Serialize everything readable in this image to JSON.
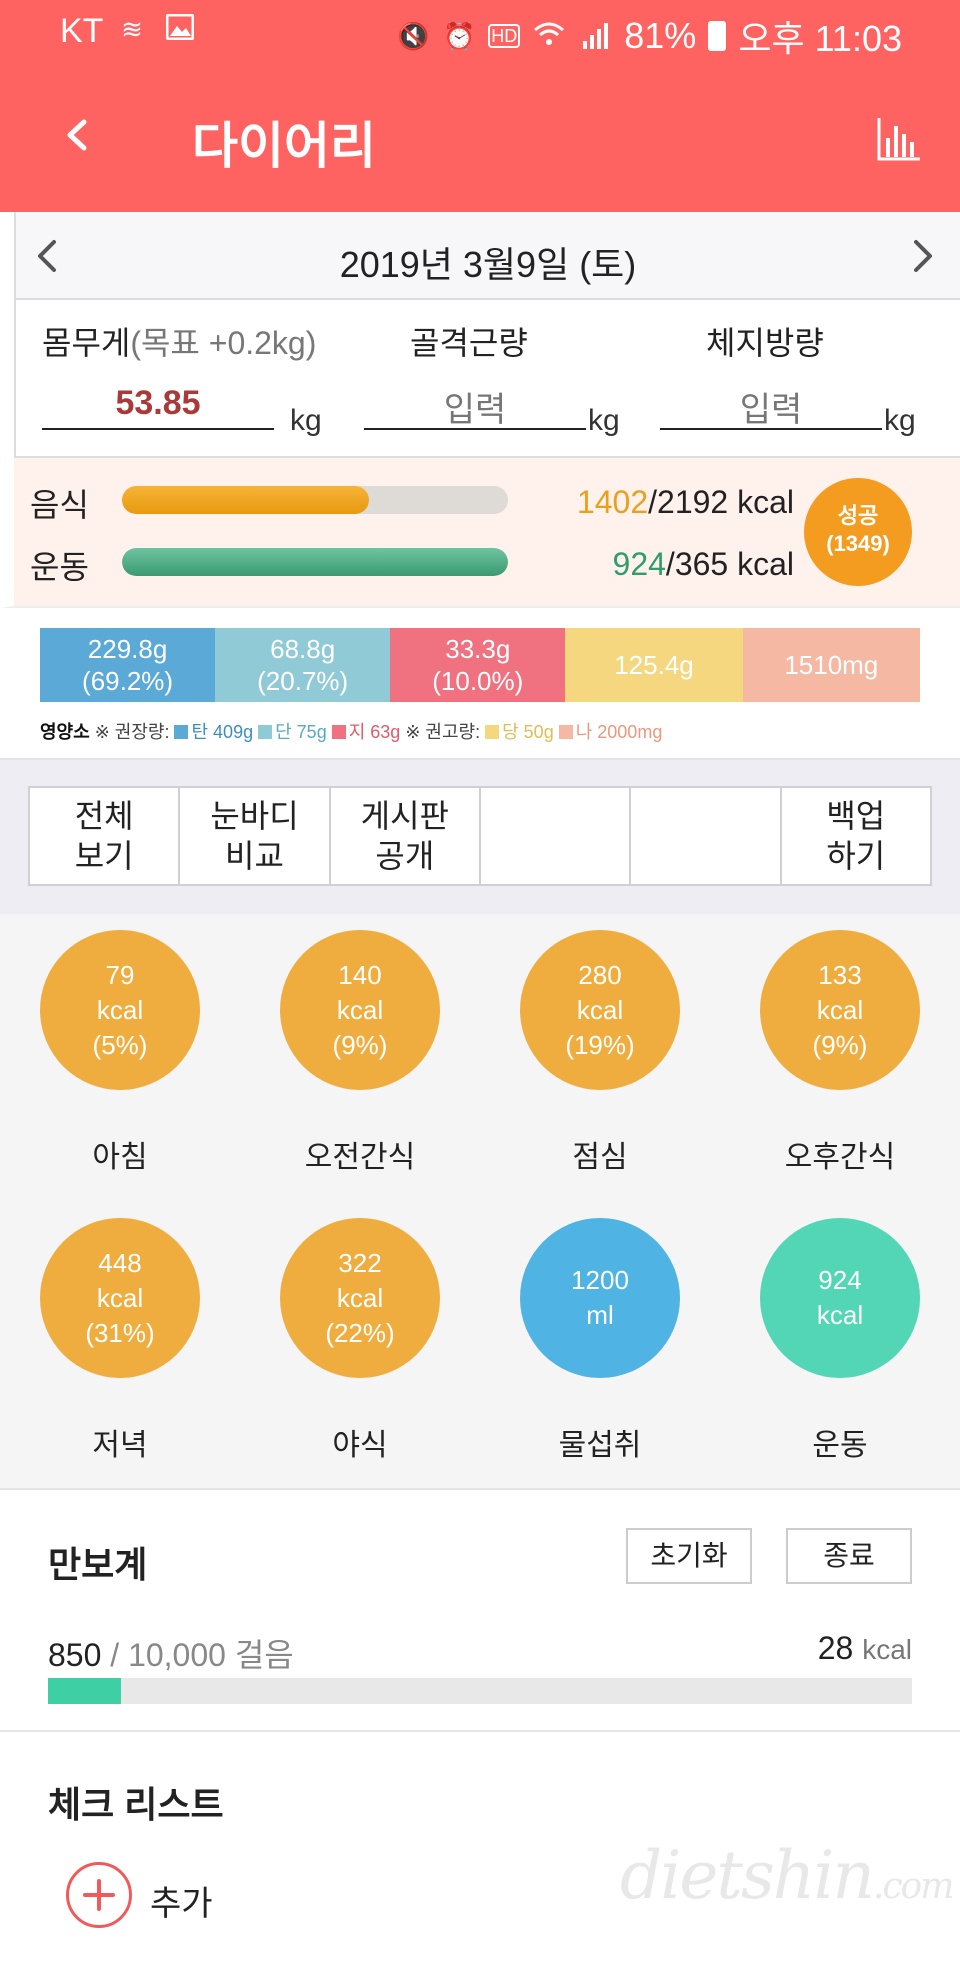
{
  "status_bar": {
    "carrier": "KT",
    "battery": "81%",
    "time": "오후 11:03",
    "left_icons": [
      "wave-icon",
      "image-icon"
    ],
    "right_icons": [
      "mute-icon",
      "alarm-icon",
      "hd-icon",
      "wifi-icon",
      "signal-icon",
      "battery-icon"
    ]
  },
  "header": {
    "title": "다이어리"
  },
  "date": {
    "label": "2019년 3월9일 (토)"
  },
  "body": {
    "weight": {
      "label": "몸무게",
      "hint": "(목표 +0.2kg)",
      "value": "53.85",
      "unit": "kg"
    },
    "muscle": {
      "label": "골격근량",
      "value": "입력",
      "unit": "kg"
    },
    "fat": {
      "label": "체지방량",
      "value": "입력",
      "unit": "kg"
    }
  },
  "calorie": {
    "food": {
      "label": "음식",
      "value": "1402",
      "target": "/2192 kcal",
      "progress": 0.64
    },
    "exercise": {
      "label": "운동",
      "value": "924",
      "target": "/365 kcal",
      "progress": 1.0
    },
    "badge": {
      "line1": "성공",
      "line2": "(1349)"
    }
  },
  "nutrients": [
    {
      "line1": "229.8g",
      "line2": "(69.2%)",
      "color": "#5aa9d6",
      "share": 0.159
    },
    {
      "line1": "68.8g",
      "line2": "(20.7%)",
      "color": "#8fcad6",
      "share": 0.159
    },
    {
      "line1": "33.3g",
      "line2": "(10.0%)",
      "color": "#f0717f",
      "share": 0.159
    },
    {
      "line1": "125.4g",
      "line2": "",
      "color": "#f5d77f",
      "share": 0.161
    },
    {
      "line1": "1510mg",
      "line2": "",
      "color": "#f5b8a3",
      "share": 0.161
    }
  ],
  "legend": {
    "title": "영양소",
    "rec": "※ 권장량:",
    "carb": "탄 409g",
    "protein": "단 75g",
    "fat": "지 63g",
    "limit": "※ 권고량:",
    "sugar": "당 50g",
    "sodium": "나 2000mg"
  },
  "actions": [
    "전체\n보기",
    "눈바디\n비교",
    "게시판\n공개",
    "",
    "",
    "백업\n하기"
  ],
  "meals": [
    {
      "kcal": "79",
      "unit": "kcal",
      "pct": "(5%)",
      "label": "아침",
      "color": "#f0ad3f"
    },
    {
      "kcal": "140",
      "unit": "kcal",
      "pct": "(9%)",
      "label": "오전간식",
      "color": "#f0ad3f"
    },
    {
      "kcal": "280",
      "unit": "kcal",
      "pct": "(19%)",
      "label": "점심",
      "color": "#f0ad3f"
    },
    {
      "kcal": "133",
      "unit": "kcal",
      "pct": "(9%)",
      "label": "오후간식",
      "color": "#f0ad3f"
    },
    {
      "kcal": "448",
      "unit": "kcal",
      "pct": "(31%)",
      "label": "저녁",
      "color": "#f0ad3f"
    },
    {
      "kcal": "322",
      "unit": "kcal",
      "pct": "(22%)",
      "label": "야식",
      "color": "#f0ad3f"
    },
    {
      "kcal": "1200",
      "unit": "ml",
      "pct": "",
      "label": "물섭취",
      "color": "#4fb3e3"
    },
    {
      "kcal": "924",
      "unit": "kcal",
      "pct": "",
      "label": "운동",
      "color": "#52d6b5"
    }
  ],
  "pedometer": {
    "title": "만보계",
    "reset": "초기화",
    "stop": "종료",
    "steps": "850",
    "goal": "/ 10,000 걸음",
    "kcal": "28",
    "kcal_unit": "kcal",
    "progress": 0.085
  },
  "checklist": {
    "title": "체크 리스트",
    "add": "추가",
    "watermark": "dietshin",
    "watermark_suffix": ".com"
  }
}
